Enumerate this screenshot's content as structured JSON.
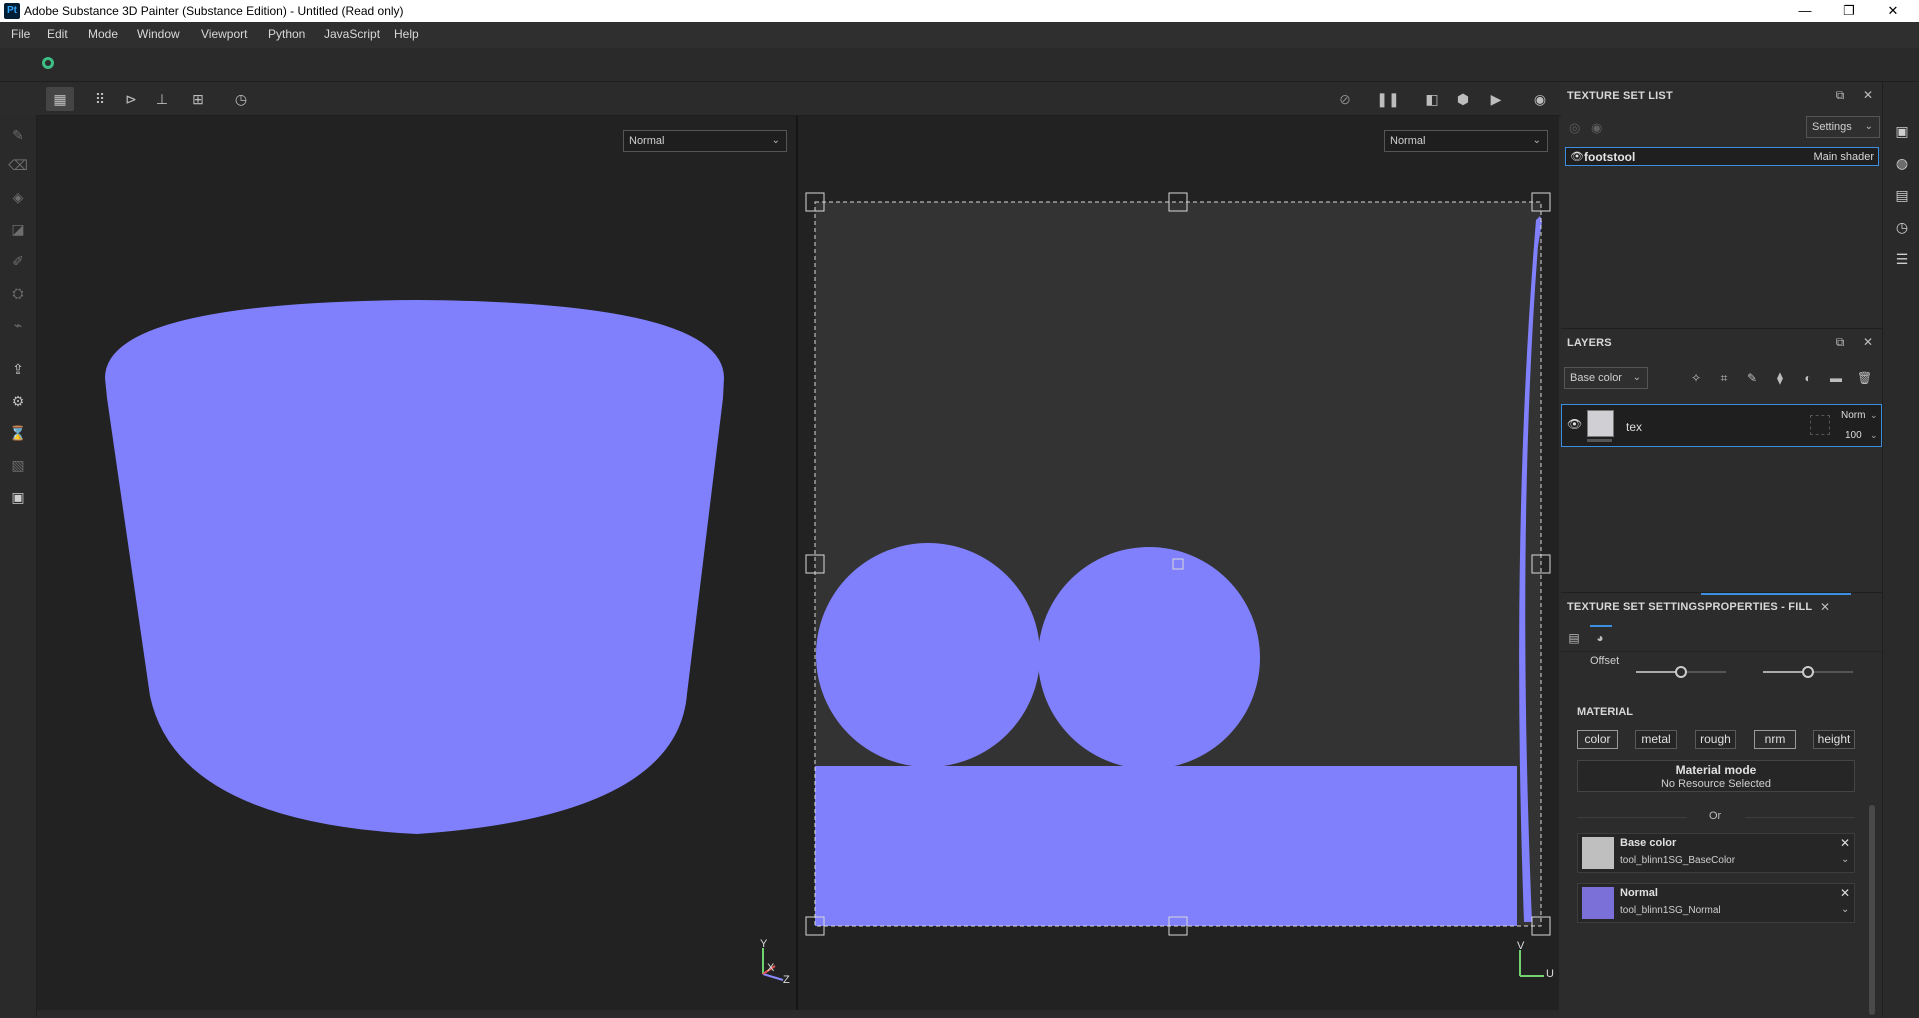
{
  "window": {
    "logo": "Pt",
    "title": "Adobe Substance 3D Painter (Substance Edition) - Untitled (Read only)",
    "min": "—",
    "max": "❐",
    "close": "✕"
  },
  "menu": [
    "File",
    "Edit",
    "Mode",
    "Window",
    "Viewport",
    "Python",
    "JavaScript",
    "Help"
  ],
  "viewport3d": {
    "mode": "Normal",
    "axis_y": "Y",
    "axis_x": "X",
    "axis_z": "Z"
  },
  "viewport2d": {
    "mode": "Normal",
    "axis_v": "V",
    "axis_u": "U"
  },
  "texture_set_list": {
    "title": "TEXTURE SET LIST",
    "settings_label": "Settings",
    "items": [
      {
        "name": "footstool",
        "shader": "Main shader"
      }
    ]
  },
  "layers": {
    "title": "LAYERS",
    "channel": "Base color",
    "items": [
      {
        "name": "tex",
        "blend": "Norm",
        "opacity": "100"
      }
    ]
  },
  "properties": {
    "tab_texture_set_settings": "TEXTURE SET SETTINGS",
    "tab_properties_fill": "PROPERTIES - FILL",
    "offset_label": "Offset",
    "material_title": "MATERIAL",
    "material_buttons": [
      "color",
      "metal",
      "rough",
      "nrm",
      "height"
    ],
    "material_mode_title": "Material mode",
    "material_mode_value": "No Resource Selected",
    "or_label": "Or",
    "channels": [
      {
        "title": "Base color",
        "resource": "tool_blinn1SG_BaseColor"
      },
      {
        "title": "Normal",
        "resource": "tool_blinn1SG_Normal"
      }
    ]
  },
  "colors": {
    "uv_fill": "#8080fd",
    "accent": "#3b8ee0",
    "status_green": "#3dbd84"
  }
}
